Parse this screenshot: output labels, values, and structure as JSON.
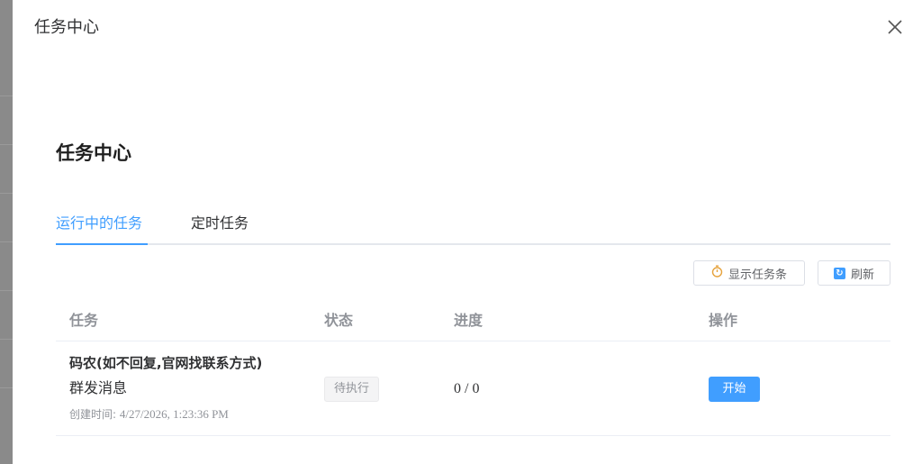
{
  "drawer": {
    "title": "任务中心"
  },
  "page": {
    "title": "任务中心"
  },
  "tabs": [
    {
      "label": "运行中的任务",
      "active": true
    },
    {
      "label": "定时任务",
      "active": false
    }
  ],
  "toolbar": {
    "show_taskbar_label": "显示任务条",
    "refresh_label": "刷新",
    "stopwatch_icon": "stopwatch-icon",
    "refresh_icon": "refresh-icon"
  },
  "table": {
    "headers": {
      "task": "任务",
      "status": "状态",
      "progress": "进度",
      "operation": "操作"
    },
    "rows": [
      {
        "name": "码农(如不回复,官网找联系方式)",
        "type": "群发消息",
        "created_label": "创建时间:",
        "created_time": "4/27/2026, 1:23:36 PM",
        "status": "待执行",
        "progress": "0 / 0",
        "action": "开始"
      }
    ]
  },
  "colors": {
    "accent": "#409eff",
    "backdrop": "#7d7d7d",
    "header_text": "#909399"
  }
}
